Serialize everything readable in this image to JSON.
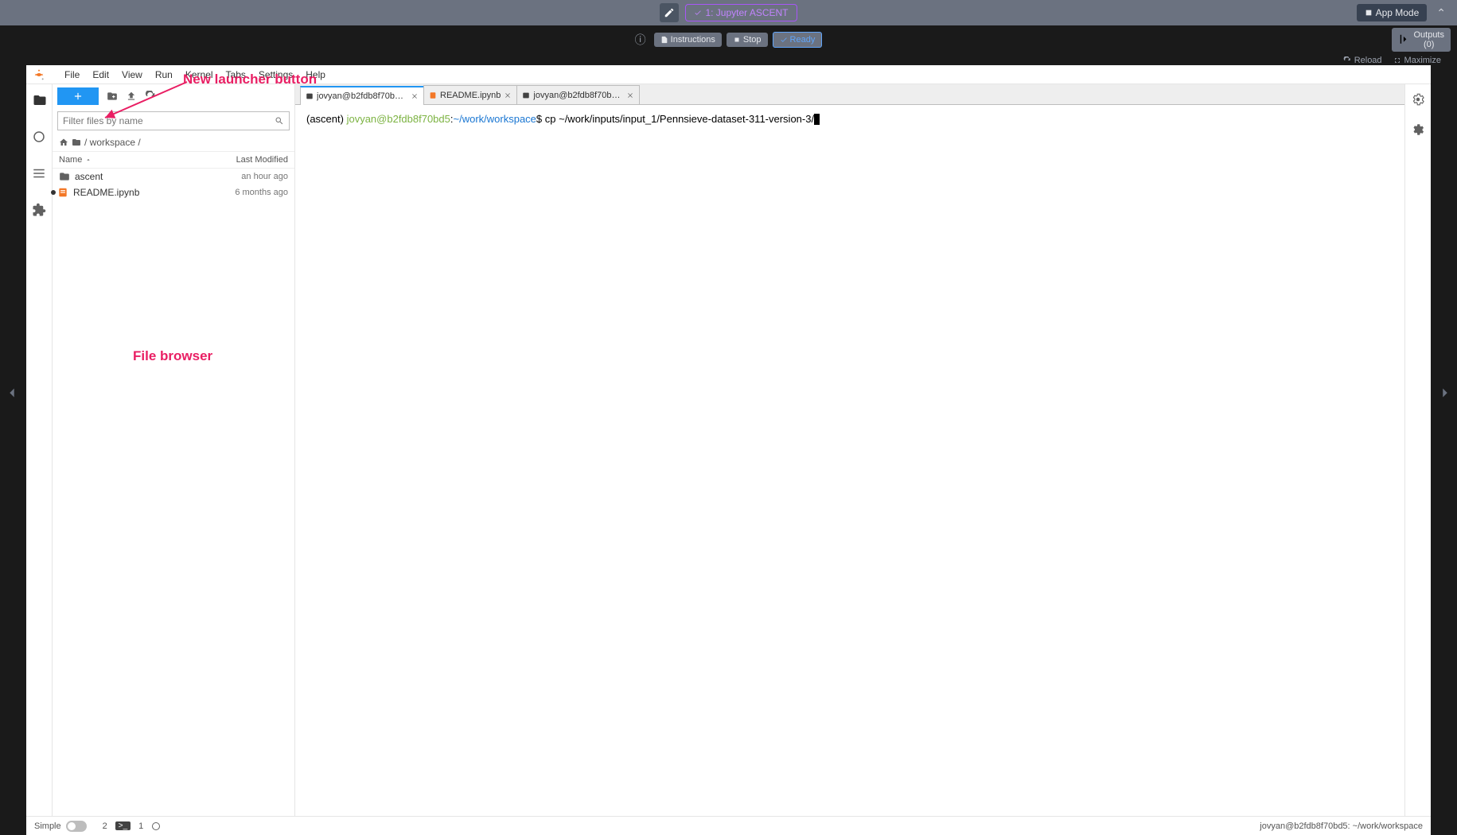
{
  "topbar": {
    "main_tab": "1: Jupyter ASCENT",
    "appmode": "App Mode"
  },
  "darkbar": {
    "instructions": "Instructions",
    "stop": "Stop",
    "ready": "Ready",
    "outputs": "Outputs (0)"
  },
  "reloadbar": {
    "reload": "Reload",
    "maximize": "Maximize"
  },
  "menu": {
    "items": [
      "File",
      "Edit",
      "View",
      "Run",
      "Kernel",
      "Tabs",
      "Settings",
      "Help"
    ]
  },
  "filter": {
    "placeholder": "Filter files by name"
  },
  "breadcrumb": {
    "path": "/ workspace /"
  },
  "columns": {
    "name": "Name",
    "modified": "Last Modified"
  },
  "files": [
    {
      "name": "ascent",
      "type": "folder",
      "modified": "an hour ago"
    },
    {
      "name": "README.ipynb",
      "type": "notebook",
      "modified": "6 months ago",
      "running": true
    }
  ],
  "tabs": [
    {
      "label": "jovyan@b2fdb8f70bd5: ~/wo",
      "type": "terminal",
      "active": true
    },
    {
      "label": "README.ipynb",
      "type": "notebook",
      "active": false
    },
    {
      "label": "jovyan@b2fdb8f70bd5: ~/wo",
      "type": "terminal",
      "active": false
    }
  ],
  "terminal": {
    "env": "(ascent) ",
    "user": "jovyan@b2fdb8f70bd5",
    "colon": ":",
    "path": "~/work/workspace",
    "dollar": "$ ",
    "command": "cp ~/work/inputs/input_1/Pennsieve-dataset-311-version-3/"
  },
  "statusbar": {
    "simple": "Simple",
    "count1": "2",
    "count2": "1",
    "path": "jovyan@b2fdb8f70bd5: ~/work/workspace"
  },
  "annotations": {
    "launcher": "New launcher button",
    "browser": "File browser"
  }
}
